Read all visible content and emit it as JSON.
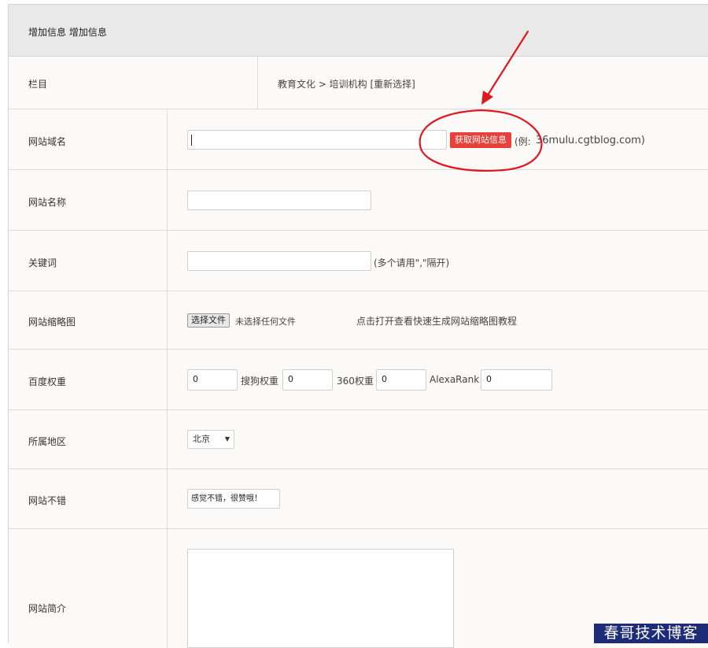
{
  "header": {
    "title": "增加信息 增加信息"
  },
  "category": {
    "label": "栏目",
    "path": "教育文化 > 培训机构 [重新选择]"
  },
  "domain": {
    "label": "网站域名",
    "value": "",
    "fetch_button": "获取网站信息",
    "example_prefix": "(例:",
    "example_value": "36mulu.cgtblog.com)"
  },
  "site_name": {
    "label": "网站名称",
    "value": ""
  },
  "keywords": {
    "label": "关键词",
    "value": "",
    "hint": "(多个请用\",\"隔开)"
  },
  "thumbnail": {
    "label": "网站缩略图",
    "choose_button": "选择文件",
    "no_file": "未选择任何文件",
    "tutorial_link": "点击打开查看快速生成网站缩略图教程"
  },
  "weights": {
    "label": "百度权重",
    "baidu_value": "0",
    "sogou_label": "搜狗权重",
    "sogou_value": "0",
    "s360_label": "360权重",
    "s360_value": "0",
    "alexa_label": "AlexaRank",
    "alexa_value": "0"
  },
  "region": {
    "label": "所属地区",
    "selected": "北京"
  },
  "rating": {
    "label": "网站不错",
    "value": "感觉不错，很赞哦！"
  },
  "intro": {
    "label": "网站简介",
    "value": ""
  },
  "watermark": {
    "text": "春哥技术博客"
  },
  "colors": {
    "button_red": "#e8403a",
    "annotation_red": "#e0171c",
    "watermark_bg": "#1e2b78"
  }
}
